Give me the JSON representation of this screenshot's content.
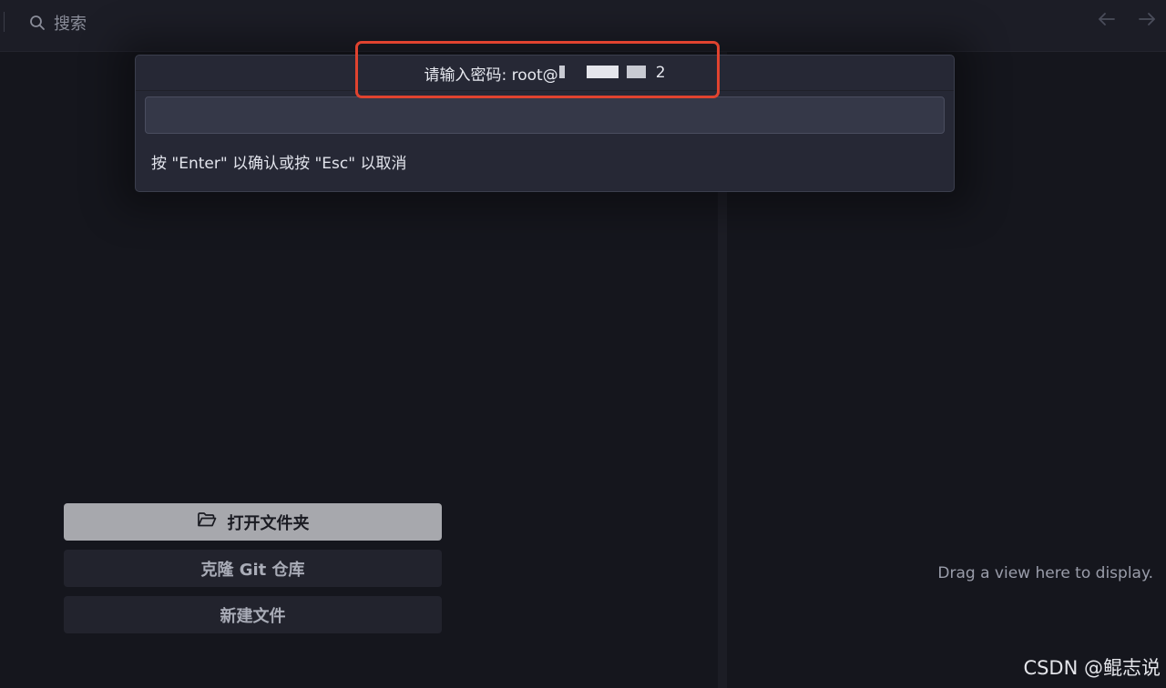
{
  "topbar": {
    "search_label": "搜索",
    "search_icon": "search-icon",
    "back_icon": "arrow-left-icon",
    "forward_icon": "arrow-right-icon"
  },
  "welcome": {
    "open_folder_label": "打开文件夹",
    "open_folder_icon": "folder-open-icon",
    "clone_git_label": "克隆 Git 仓库",
    "new_file_label": "新建文件"
  },
  "right_pane": {
    "hint": "Drag a view here to display."
  },
  "prompt": {
    "title_prefix": "请输入密码: root@",
    "title_suffix": "2",
    "input_value": "",
    "input_placeholder": "",
    "hint": "按 \"Enter\" 以确认或按 \"Esc\" 以取消"
  },
  "watermark": "CSDN @鲲志说",
  "colors": {
    "background": "#15161d",
    "modal_bg": "#262835",
    "input_bg": "#353848",
    "open_button_bg": "#a7a8ad",
    "secondary_button_bg": "#22232d",
    "highlight_border": "#e0432f"
  }
}
